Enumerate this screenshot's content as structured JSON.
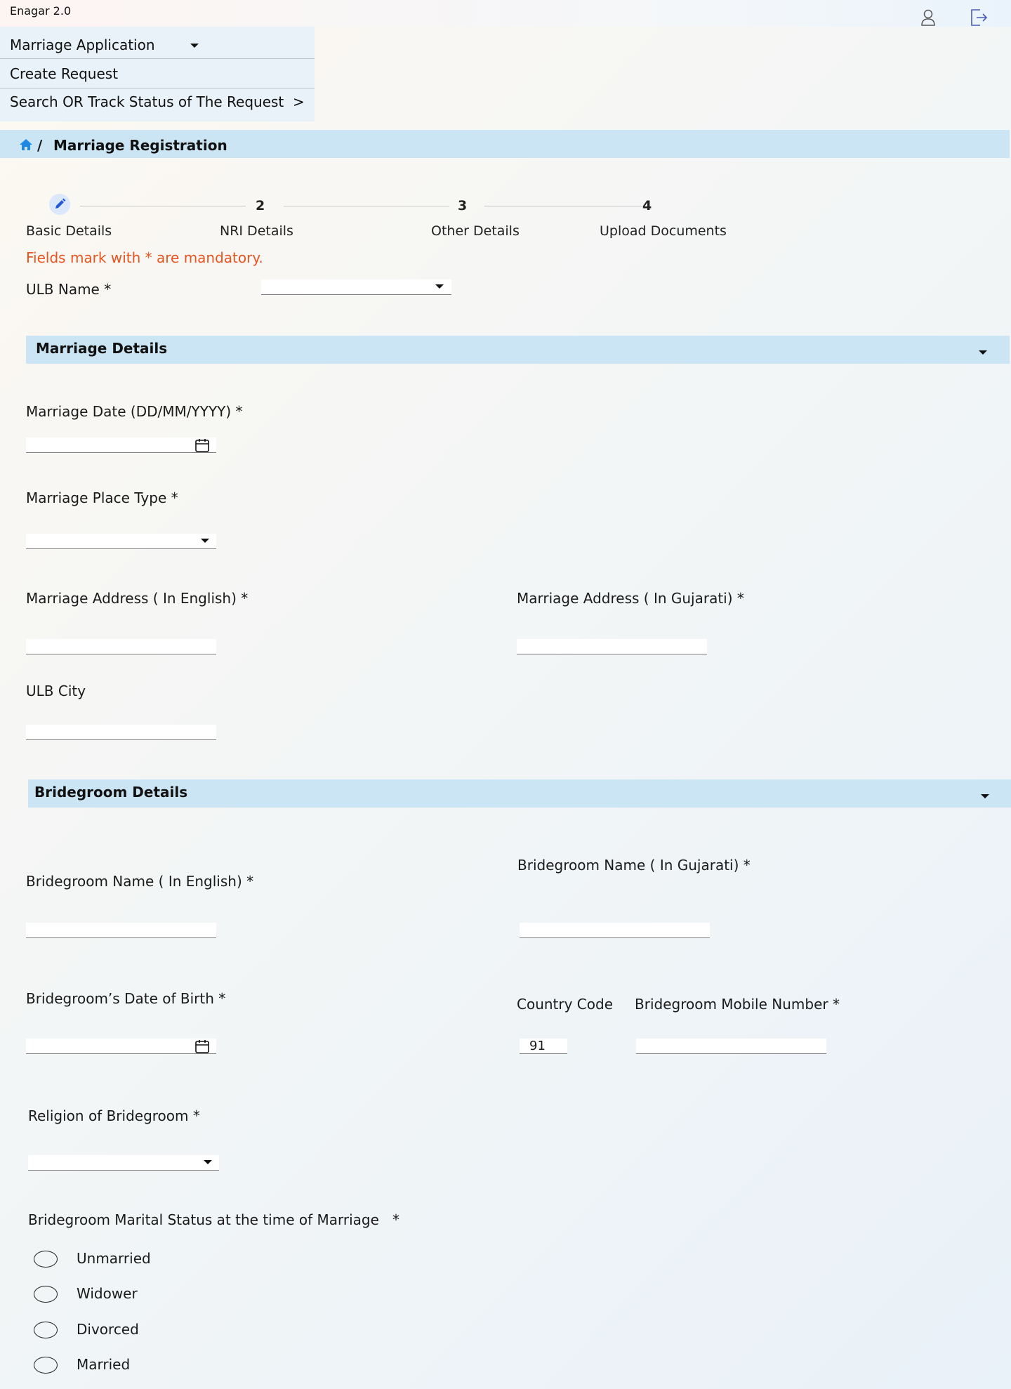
{
  "app": {
    "title": "Enagar 2.0",
    "profile_icon": "user-icon",
    "logout_icon": "logout-icon"
  },
  "menu": {
    "items": [
      {
        "label": "Marriage Application",
        "icon": "chevron-down-icon"
      },
      {
        "label": "Create Request"
      },
      {
        "label": "Search OR Track Status of The Request  >"
      }
    ]
  },
  "breadcrumb": {
    "home_icon": "home-icon",
    "separator": "/",
    "current": "Marriage Registration"
  },
  "stepper": {
    "steps": [
      {
        "number": "",
        "label": "Basic Details",
        "icon": "pencil-icon",
        "active": true
      },
      {
        "number": "2",
        "label": "NRI Details"
      },
      {
        "number": "3",
        "label": "Other Details"
      },
      {
        "number": "4",
        "label": "Upload Documents"
      }
    ]
  },
  "form": {
    "mandatory_note": "Fields mark with * are mandatory.",
    "ulb_name": {
      "label": "ULB Name *",
      "value": ""
    },
    "marriage_details": {
      "title": "Marriage Details",
      "marriage_date": {
        "label": "Marriage Date (DD/MM/YYYY) *",
        "value": ""
      },
      "marriage_place_type": {
        "label": "Marriage Place Type *",
        "value": ""
      },
      "address_english": {
        "label": "Marriage Address ( In English)  *",
        "value": ""
      },
      "address_gujarati": {
        "label": "Marriage Address ( In Gujarati)  *",
        "value": ""
      },
      "ulb_city": {
        "label": "ULB City",
        "value": ""
      }
    },
    "bridegroom_details": {
      "title": "Bridegroom Details",
      "name_english": {
        "label": "Bridegroom Name ( In English) *",
        "value": ""
      },
      "name_gujarati": {
        "label": "Bridegroom Name ( In Gujarati) *",
        "value": ""
      },
      "dob": {
        "label": "Bridegroom’s Date of Birth  *",
        "value": ""
      },
      "country_code": {
        "label": "Country Code",
        "value": "91"
      },
      "mobile": {
        "label": "Bridegroom Mobile Number *",
        "value": ""
      },
      "religion": {
        "label": "Religion of Bridegroom  *",
        "value": ""
      },
      "marital_status": {
        "label": "Bridegroom Marital Status at the time of Marriage   *",
        "options": [
          "Unmarried",
          "Widower",
          "Divorced",
          "Married"
        ]
      }
    }
  },
  "colors": {
    "accent_bar": "#cce5f5",
    "mandatory": "#e8541f",
    "icon_blue": "#1e88e5"
  }
}
